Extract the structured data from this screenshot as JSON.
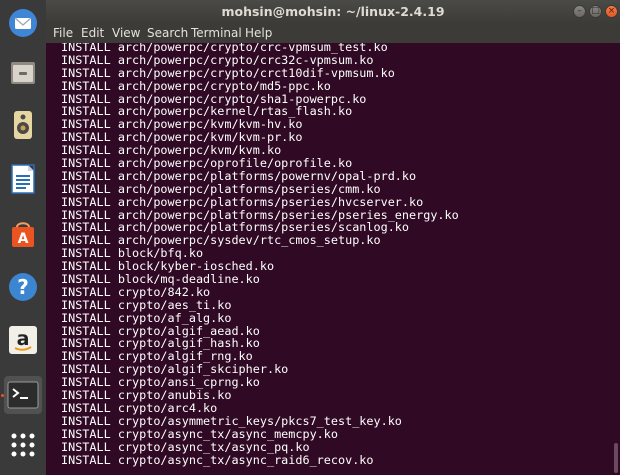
{
  "window": {
    "title": "mohsin@mohsin: ~/linux-2.4.19",
    "close_glyph": "×",
    "minimize_glyph": "–",
    "maximize_glyph": "□"
  },
  "menu": [
    "File",
    "Edit",
    "View",
    "Search",
    "Terminal",
    "Help"
  ],
  "dock": [
    {
      "name": "thunderbird-mail-icon"
    },
    {
      "name": "files-icon"
    },
    {
      "name": "rhythmbox-speaker-icon"
    },
    {
      "name": "libreoffice-writer-icon"
    },
    {
      "name": "ubuntu-software-icon"
    },
    {
      "name": "help-icon"
    },
    {
      "name": "amazon-icon"
    },
    {
      "name": "terminal-icon",
      "active": true
    },
    {
      "name": "show-applications-icon"
    }
  ],
  "terminal": {
    "lines": [
      "INSTALL arch/powerpc/crypto/crc-vpmsum_test.ko",
      "INSTALL arch/powerpc/crypto/crc32c-vpmsum.ko",
      "INSTALL arch/powerpc/crypto/crct10dif-vpmsum.ko",
      "INSTALL arch/powerpc/crypto/md5-ppc.ko",
      "INSTALL arch/powerpc/crypto/sha1-powerpc.ko",
      "INSTALL arch/powerpc/kernel/rtas_flash.ko",
      "INSTALL arch/powerpc/kvm/kvm-hv.ko",
      "INSTALL arch/powerpc/kvm/kvm-pr.ko",
      "INSTALL arch/powerpc/kvm/kvm.ko",
      "INSTALL arch/powerpc/oprofile/oprofile.ko",
      "INSTALL arch/powerpc/platforms/powernv/opal-prd.ko",
      "INSTALL arch/powerpc/platforms/pseries/cmm.ko",
      "INSTALL arch/powerpc/platforms/pseries/hvcserver.ko",
      "INSTALL arch/powerpc/platforms/pseries/pseries_energy.ko",
      "INSTALL arch/powerpc/platforms/pseries/scanlog.ko",
      "INSTALL arch/powerpc/sysdev/rtc_cmos_setup.ko",
      "INSTALL block/bfq.ko",
      "INSTALL block/kyber-iosched.ko",
      "INSTALL block/mq-deadline.ko",
      "INSTALL crypto/842.ko",
      "INSTALL crypto/aes_ti.ko",
      "INSTALL crypto/af_alg.ko",
      "INSTALL crypto/algif_aead.ko",
      "INSTALL crypto/algif_hash.ko",
      "INSTALL crypto/algif_rng.ko",
      "INSTALL crypto/algif_skcipher.ko",
      "INSTALL crypto/ansi_cprng.ko",
      "INSTALL crypto/anubis.ko",
      "INSTALL crypto/arc4.ko",
      "INSTALL crypto/asymmetric_keys/pkcs7_test_key.ko",
      "INSTALL crypto/async_tx/async_memcpy.ko",
      "INSTALL crypto/async_tx/async_pq.ko",
      "INSTALL crypto/async_tx/async_raid6_recov.ko"
    ]
  },
  "colors": {
    "terminal_bg": "#300a24",
    "terminal_fg": "#ffffff",
    "titlebar": "#3c3b37",
    "dock_bg": "#3a3a3a",
    "accent": "#e95420"
  }
}
